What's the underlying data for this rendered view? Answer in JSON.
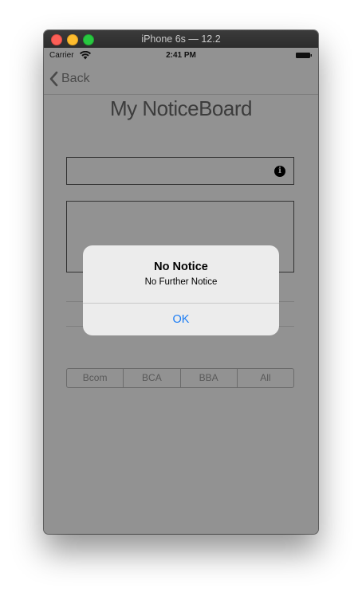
{
  "window": {
    "title": "iPhone 6s — 12.2"
  },
  "statusbar": {
    "carrier": "Carrier",
    "time": "2:41 PM"
  },
  "navbar": {
    "back_label": "Back"
  },
  "page": {
    "title": "My NoticeBoard",
    "title_input_value": "",
    "notice_text_value": ""
  },
  "segments": {
    "items": [
      "Bcom",
      "BCA",
      "BBA",
      "All"
    ]
  },
  "alert": {
    "title": "No Notice",
    "message": "No Further Notice",
    "ok_label": "OK"
  },
  "icons": {
    "info": "info-icon",
    "back": "back-chevron-icon",
    "wifi": "wifi-icon",
    "battery": "battery-icon"
  },
  "colors": {
    "accent": "#1a7cf5",
    "dim_background": "#929292",
    "alert_background": "#ececec"
  }
}
